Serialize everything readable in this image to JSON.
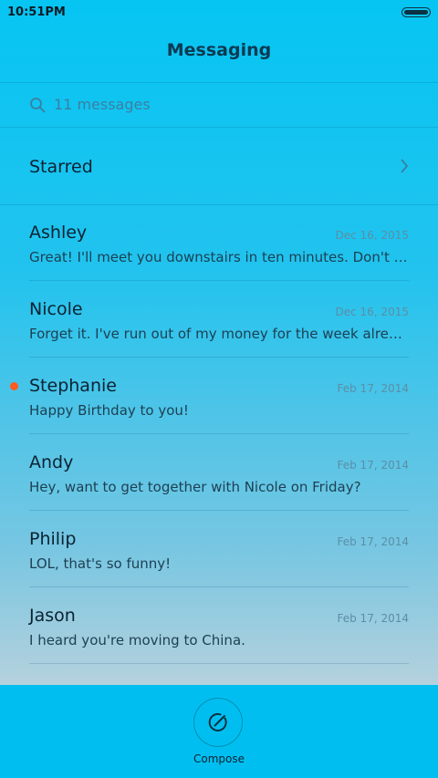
{
  "status_bar": {
    "time": "10:51PM"
  },
  "header": {
    "title": "Messaging"
  },
  "search": {
    "placeholder": "11 messages"
  },
  "starred": {
    "label": "Starred"
  },
  "messages": [
    {
      "name": "Ashley",
      "date": "Dec 16, 2015",
      "preview": "Great! I'll meet you downstairs in ten minutes. Don't forget",
      "unread": false
    },
    {
      "name": "Nicole",
      "date": "Dec 16, 2015",
      "preview": "Forget it. I've run out of my money for the week already.",
      "unread": false
    },
    {
      "name": "Stephanie",
      "date": "Feb 17, 2014",
      "preview": "Happy Birthday to you!",
      "unread": true
    },
    {
      "name": "Andy",
      "date": "Feb 17, 2014",
      "preview": "Hey, want to get together with Nicole on Friday?",
      "unread": false
    },
    {
      "name": "Philip",
      "date": "Feb 17, 2014",
      "preview": "LOL, that's so funny!",
      "unread": false
    },
    {
      "name": "Jason",
      "date": "Feb 17, 2014",
      "preview": "I heard you're moving to China.",
      "unread": false
    }
  ],
  "bottom_bar": {
    "compose_label": "Compose"
  },
  "colors": {
    "accent": "#00bff0",
    "unread_dot": "#ff5a1f"
  }
}
